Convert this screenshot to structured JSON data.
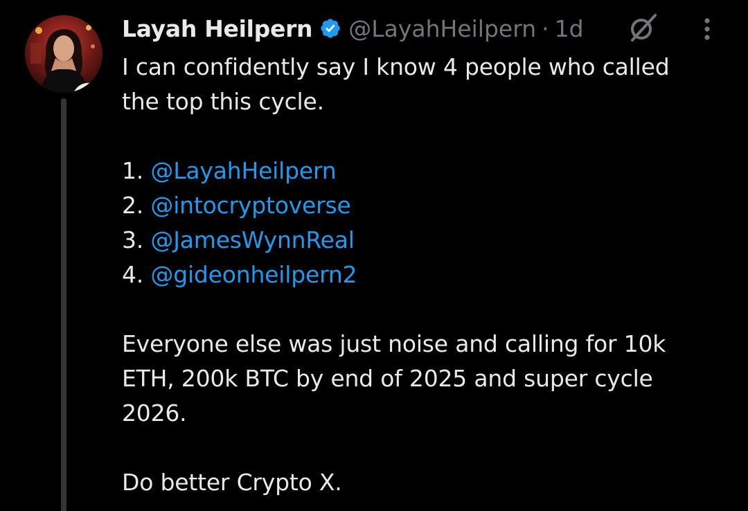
{
  "author": {
    "name": "Layah Heilpern",
    "handle": "@LayahHeilpern",
    "separator": "·",
    "time": "1d",
    "verified_color": "#1d9bf0"
  },
  "icons": {
    "verified": "verified-badge-icon",
    "grok": "grok-icon",
    "more": "more-vertical-icon"
  },
  "tweet": {
    "intro_line_1": "I can confidently say I know 4 people who called",
    "intro_line_2": "the top this cycle.",
    "list": [
      {
        "number": "1.",
        "mention": "@LayahHeilpern"
      },
      {
        "number": "2.",
        "mention": "@intocryptoverse"
      },
      {
        "number": "3.",
        "mention": "@JamesWynnReal"
      },
      {
        "number": "4.",
        "mention": "@gideonheilpern2"
      }
    ],
    "para_line_1": "Everyone else was just noise and calling for 10k",
    "para_line_2": "ETH, 200k BTC by end of 2025 and super cycle",
    "para_line_3": "2026.",
    "closing": "Do better Crypto X."
  },
  "colors": {
    "background": "#000000",
    "text": "#e7e9ea",
    "secondary": "#71767b",
    "link": "#1d9bf0"
  }
}
